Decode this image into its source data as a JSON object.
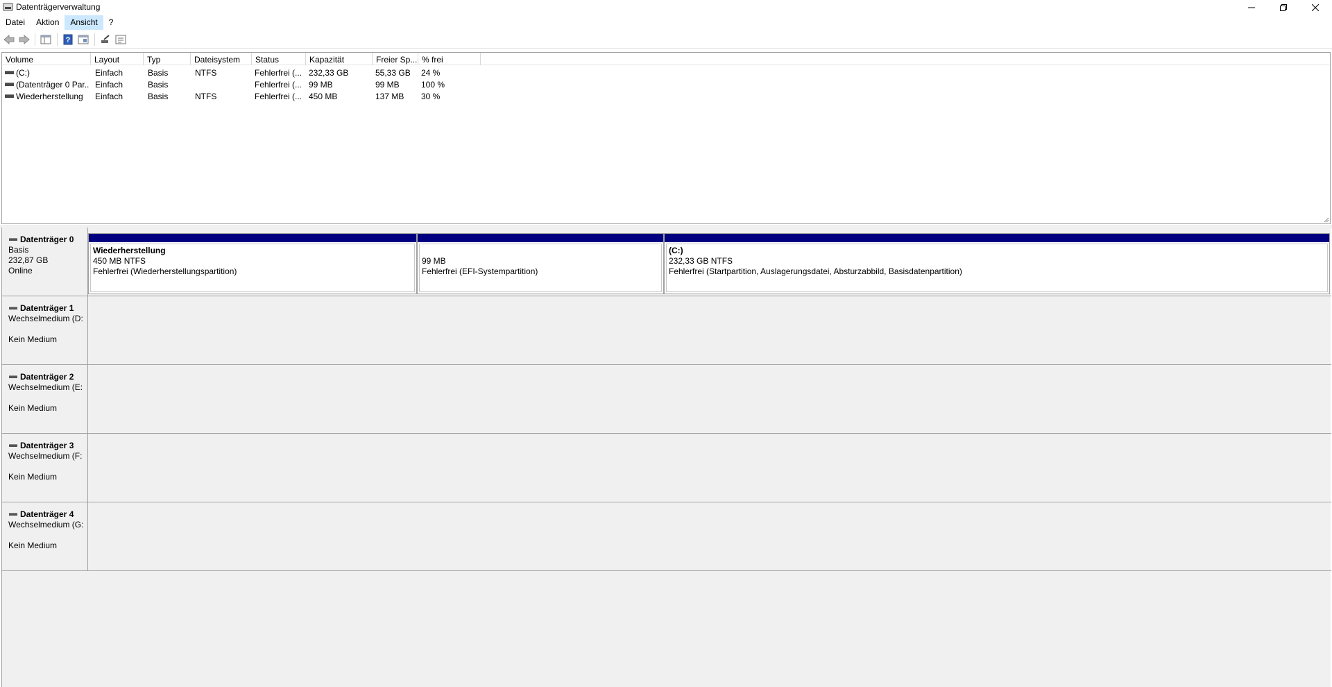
{
  "window": {
    "title": "Datenträgerverwaltung"
  },
  "menu": [
    {
      "label": "Datei"
    },
    {
      "label": "Aktion"
    },
    {
      "label": "Ansicht"
    },
    {
      "label": "?"
    }
  ],
  "toolbar": {
    "icons": [
      "back-arrow-icon",
      "forward-arrow-icon",
      "console-tree-icon",
      "help-icon",
      "properties-icon",
      "rescan-icon",
      "settings-list-icon"
    ]
  },
  "volume_list": {
    "columns": [
      "Volume",
      "Layout",
      "Typ",
      "Dateisystem",
      "Status",
      "Kapazität",
      "Freier Sp...",
      "% frei"
    ],
    "rows": [
      {
        "volume": " (C:)",
        "layout": "Einfach",
        "typ": "Basis",
        "dateisystem": "NTFS",
        "status": "Fehlerfrei (...",
        "kapazitaet": "232,33 GB",
        "frei": "55,33 GB",
        "prozent": "24 %"
      },
      {
        "volume": "(Datenträger 0 Par...",
        "layout": "Einfach",
        "typ": "Basis",
        "dateisystem": "",
        "status": "Fehlerfrei (...",
        "kapazitaet": "99 MB",
        "frei": "99 MB",
        "prozent": "100 %"
      },
      {
        "volume": "Wiederherstellung",
        "layout": "Einfach",
        "typ": "Basis",
        "dateisystem": "NTFS",
        "status": "Fehlerfrei (...",
        "kapazitaet": "450 MB",
        "frei": "137 MB",
        "prozent": "30 %"
      }
    ]
  },
  "disks": [
    {
      "name": "Datenträger 0",
      "line1": "Basis",
      "line2": "232,87 GB",
      "line3": "Online",
      "partitions": [
        {
          "name": "Wiederherstellung",
          "size": "450 MB NTFS",
          "status": "Fehlerfrei (Wiederherstellungspartition)"
        },
        {
          "name": "",
          "size": "99 MB",
          "status": "Fehlerfrei (EFI-Systempartition)"
        },
        {
          "name": " (C:)",
          "size": "232,33 GB NTFS",
          "status": "Fehlerfrei (Startpartition, Auslagerungsdatei, Absturzabbild, Basisdatenpartition)"
        }
      ]
    },
    {
      "name": "Datenträger 1",
      "line1": "Wechselmedium (D:",
      "line3": "Kein Medium"
    },
    {
      "name": "Datenträger 2",
      "line1": "Wechselmedium (E:",
      "line3": "Kein Medium"
    },
    {
      "name": "Datenträger 3",
      "line1": "Wechselmedium (F:",
      "line3": "Kein Medium"
    },
    {
      "name": "Datenträger 4",
      "line1": "Wechselmedium (G:",
      "line3": "Kein Medium"
    }
  ],
  "colors": {
    "partition_bar": "#000080",
    "menu_highlight": "#cce8ff"
  }
}
